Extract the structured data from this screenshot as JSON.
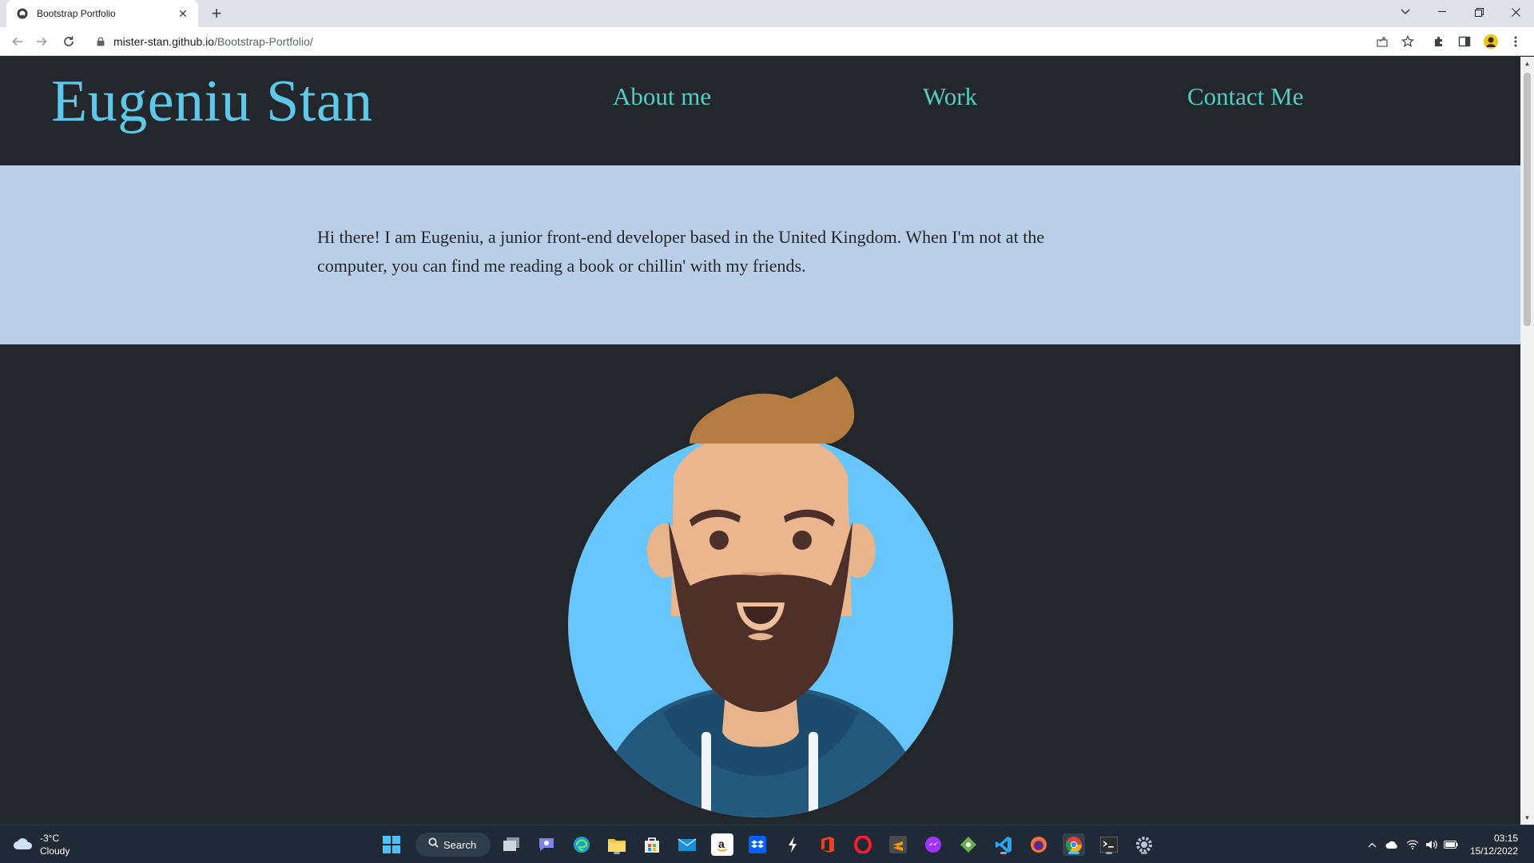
{
  "browser": {
    "tab_title": "Bootstrap Portfolio",
    "url_host": "mister-stan.github.io",
    "url_path": "/Bootstrap-Portfolio/"
  },
  "site": {
    "brand": "Eugeniu Stan",
    "nav": [
      {
        "label": "About me"
      },
      {
        "label": "Work"
      },
      {
        "label": "Contact Me"
      }
    ],
    "about_line1": "Hi there! I am Eugeniu, a junior front-end developer based in the United Kingdom. When I'm not at the",
    "about_line2": "computer, you can find me reading a book or chillin' with my friends."
  },
  "taskbar": {
    "weather_temp": "-3°C",
    "weather_desc": "Cloudy",
    "search_label": "Search",
    "time": "03:15",
    "date": "15/12/2022"
  },
  "colors": {
    "page_dark": "#23262a",
    "about_bg": "#b9cfe7",
    "brand": "#5ec8e8",
    "nav": "#4fcfc6"
  }
}
